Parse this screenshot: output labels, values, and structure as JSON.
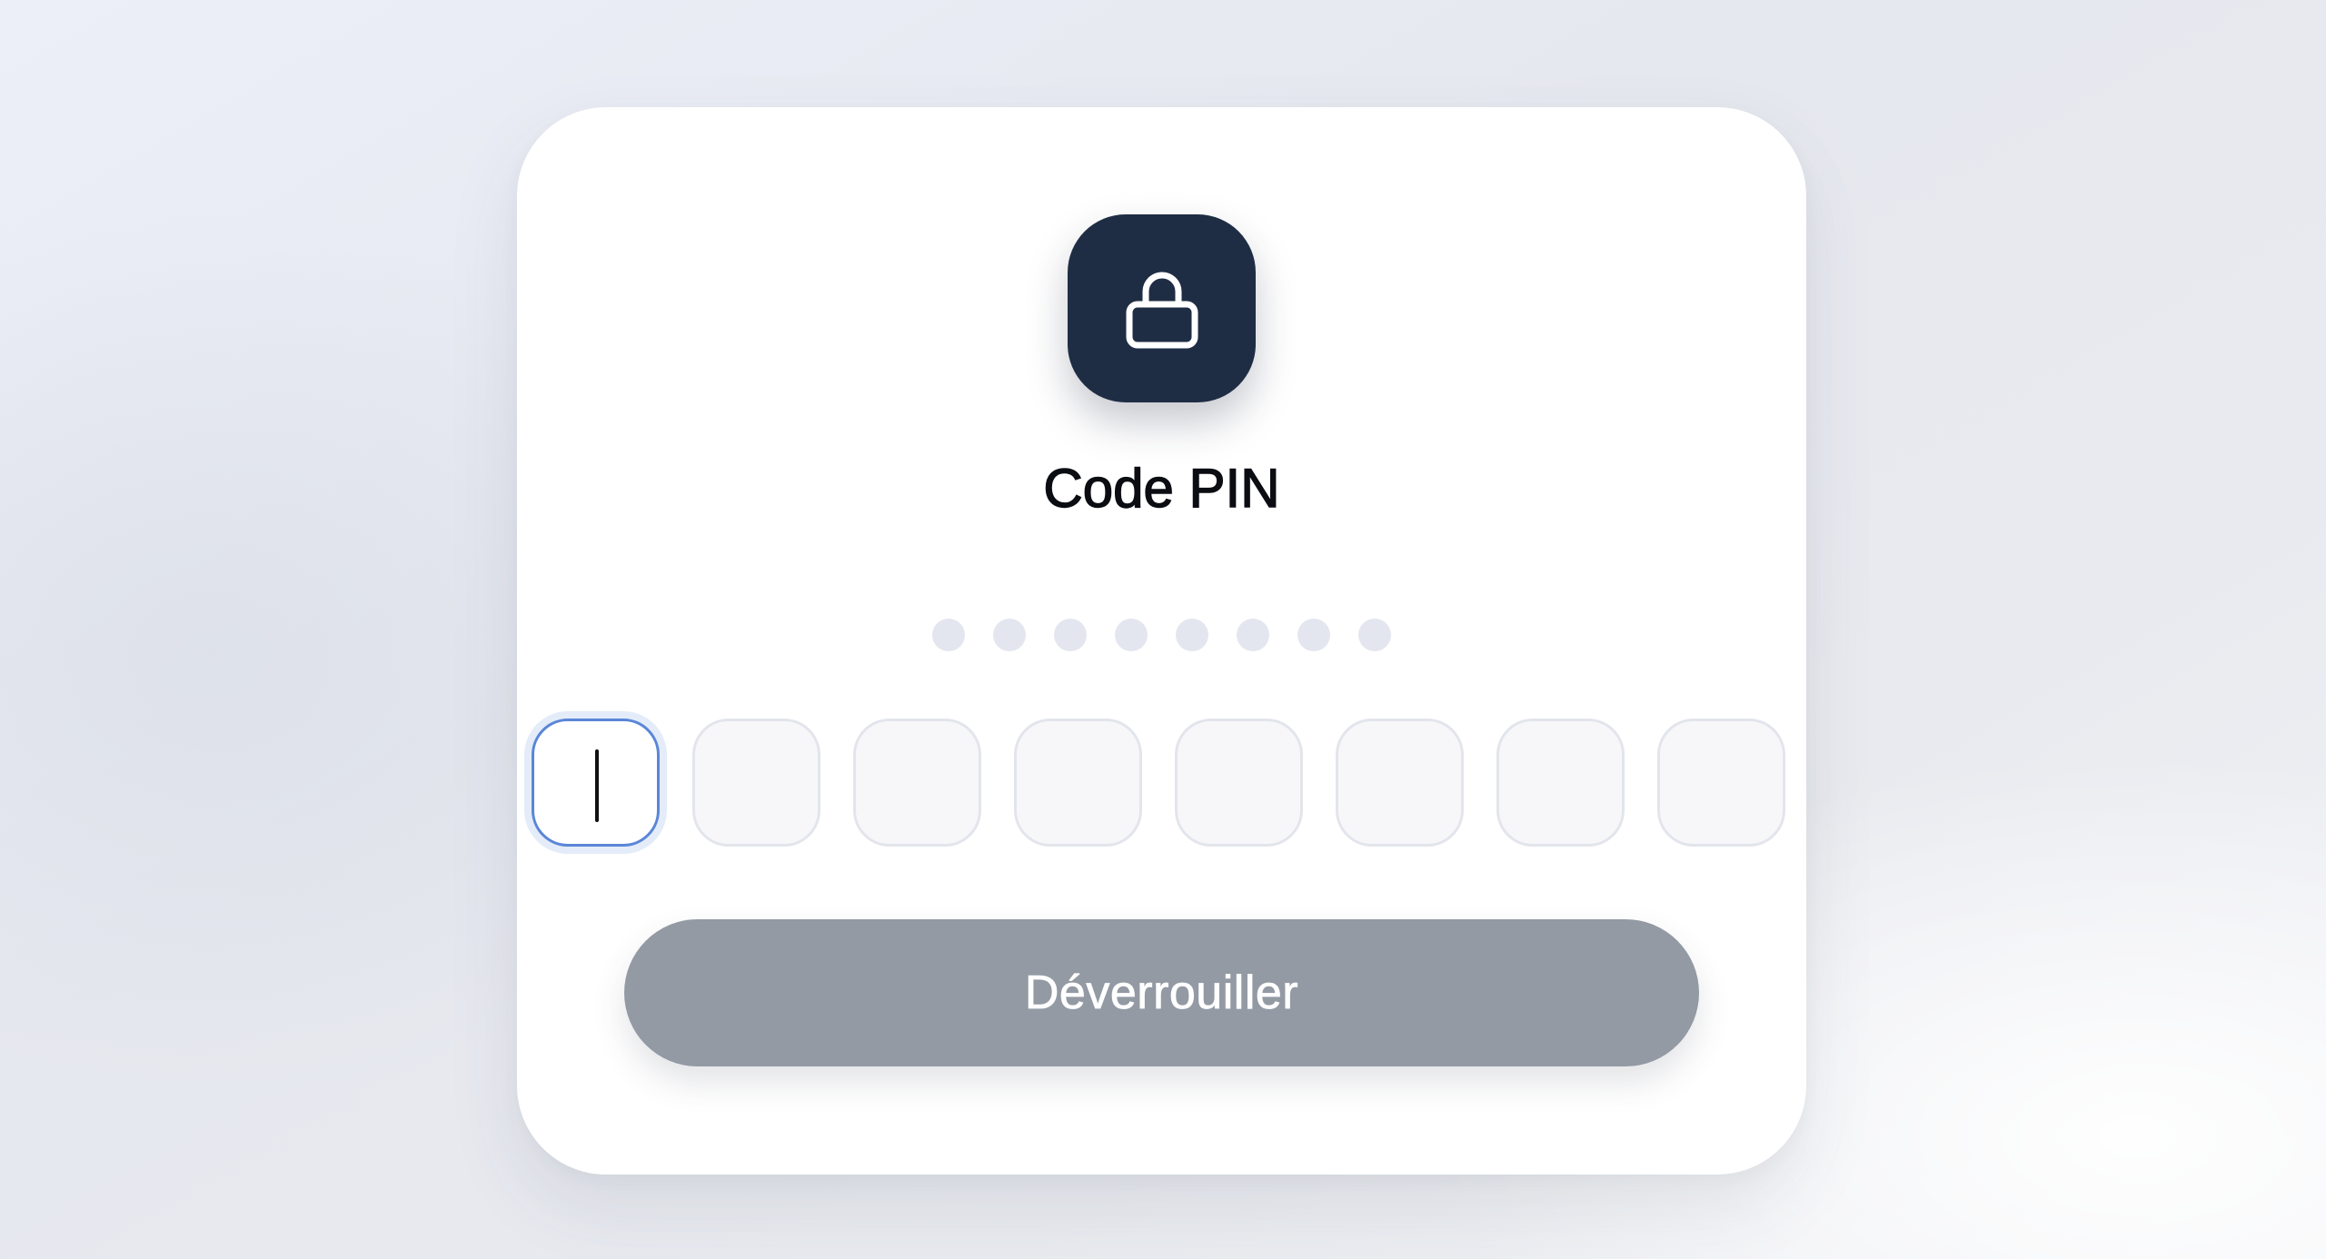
{
  "colors": {
    "lock_tile": "#1f2d44",
    "dot_empty": "#e4e6ef",
    "button_disabled": "#939aa4",
    "focus_border": "#5a86d8"
  },
  "header": {
    "icon": "lock-icon",
    "title": "Code PIN"
  },
  "pin": {
    "length": 8,
    "filled": 0,
    "active_index": 0
  },
  "unlock_button": {
    "label": "Déverrouiller",
    "state": "disabled"
  }
}
